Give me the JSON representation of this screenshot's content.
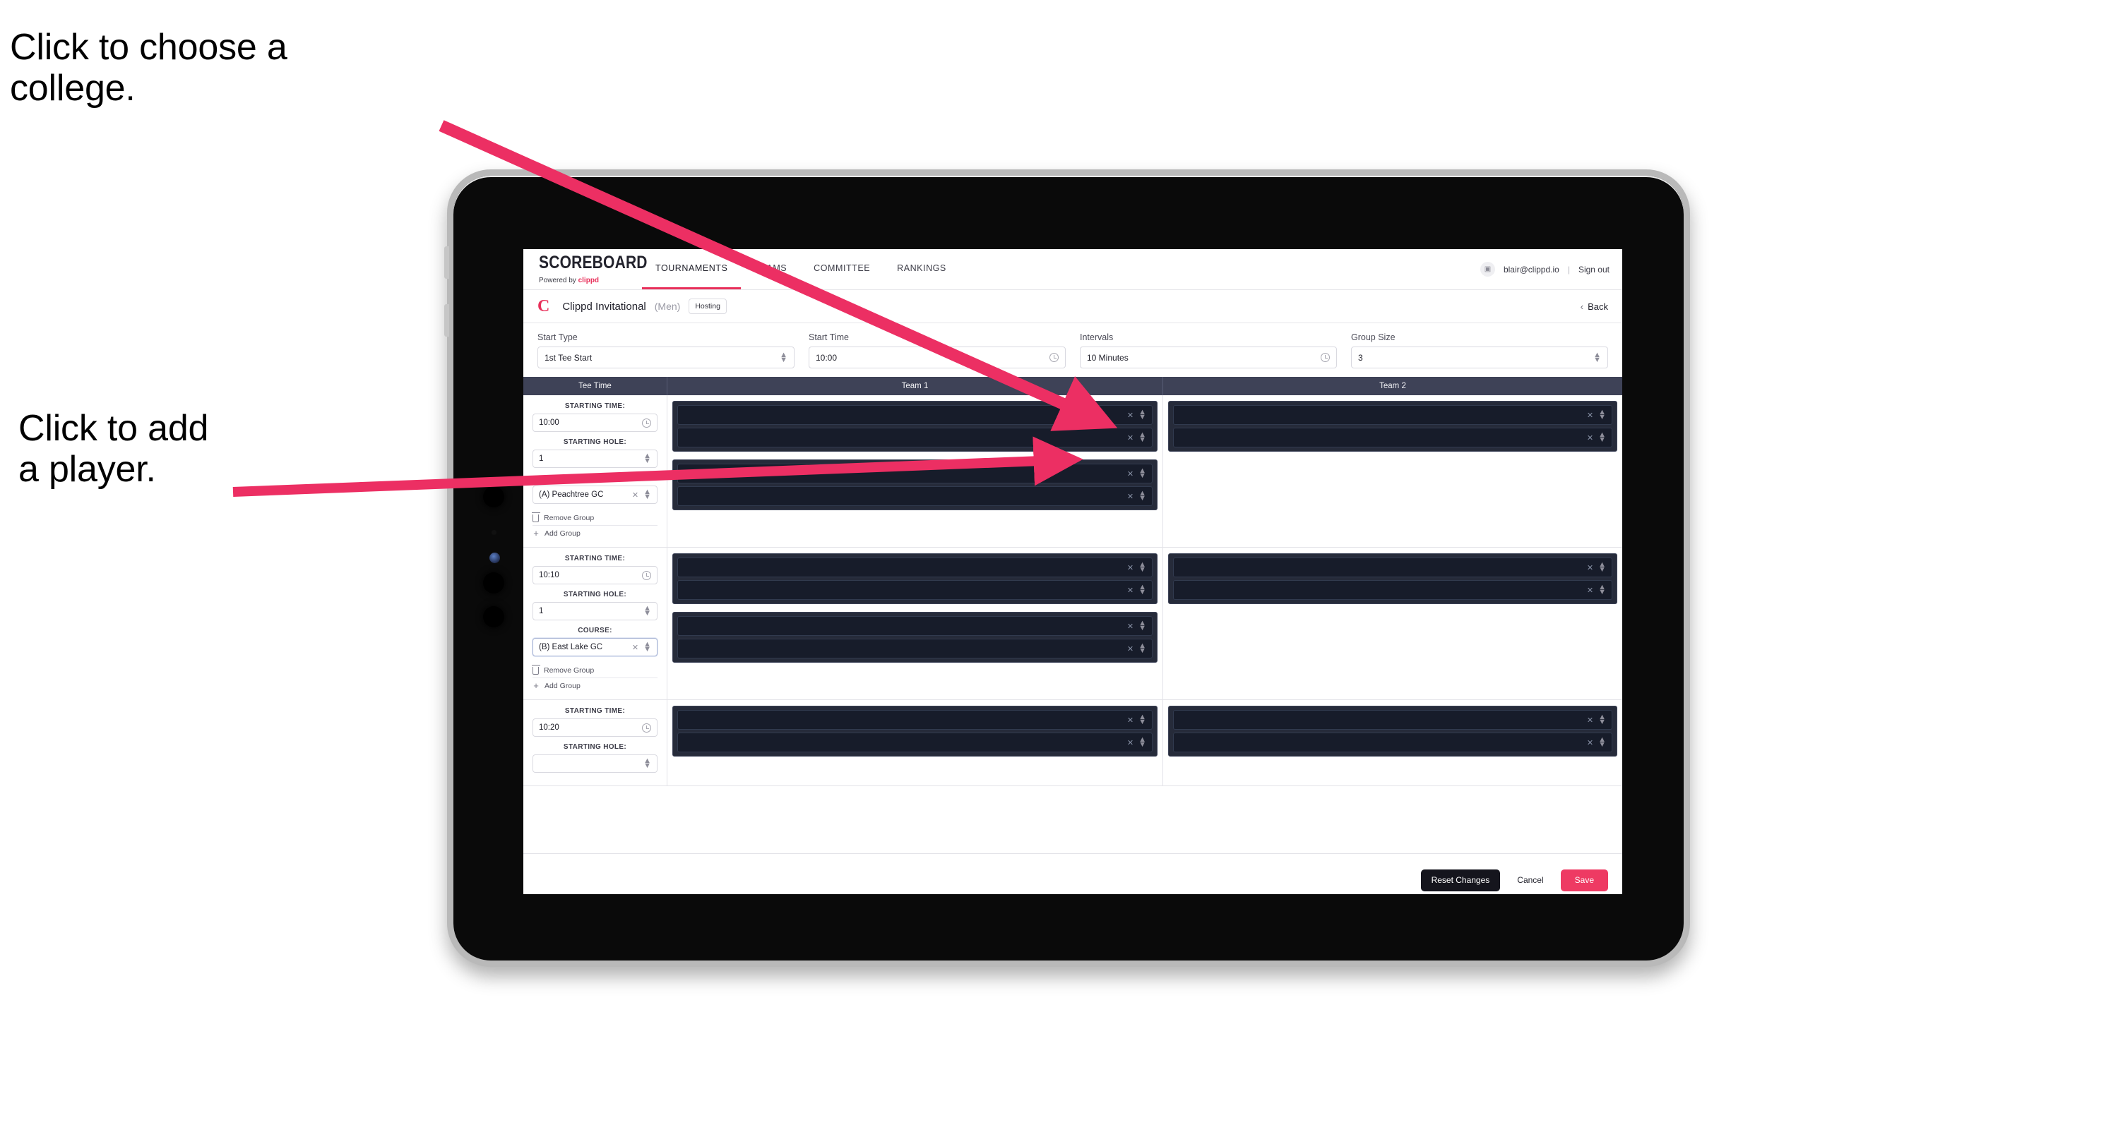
{
  "annotations": {
    "choose_college": "Click to choose a\ncollege.",
    "add_player": "Click to add\na player."
  },
  "app": {
    "brand": {
      "name": "SCOREBOARD",
      "powered_prefix": "Powered by ",
      "powered_brand": "clippd"
    },
    "nav_tabs": [
      {
        "label": "TOURNAMENTS",
        "active": true
      },
      {
        "label": "TEAMS",
        "active": false
      },
      {
        "label": "COMMITTEE",
        "active": false
      },
      {
        "label": "RANKINGS",
        "active": false
      }
    ],
    "account": {
      "avatar_icon": "user-avatar-icon",
      "email": "blair@clippd.io",
      "separator": "|",
      "sign_out": "Sign out"
    },
    "breadcrumb": {
      "logo_letter": "C",
      "title": "Clippd Invitational",
      "gender": "(Men)",
      "status_badge": "Hosting",
      "back_label": "Back",
      "back_chevron": "‹"
    },
    "settings": [
      {
        "label": "Start Type",
        "value": "1st Tee Start",
        "adorn": "stepper"
      },
      {
        "label": "Start Time",
        "value": "10:00",
        "adorn": "clock"
      },
      {
        "label": "Intervals",
        "value": "10 Minutes",
        "adorn": "clock"
      },
      {
        "label": "Group Size",
        "value": "3",
        "adorn": "stepper"
      }
    ],
    "table": {
      "headers": [
        "Tee Time",
        "Team 1",
        "Team 2"
      ],
      "field_labels": {
        "starting_time": "STARTING TIME:",
        "starting_hole": "STARTING HOLE:",
        "course": "COURSE:"
      },
      "group_actions": {
        "remove": "Remove Group",
        "add": "Add Group"
      },
      "tee_blocks": [
        {
          "starting_time": "10:00",
          "starting_hole": "1",
          "course": "(A) Peachtree GC",
          "course_focused": false,
          "team1_groups": [
            {
              "players": 2
            },
            {
              "players": 2
            }
          ],
          "team2_groups": [
            {
              "players": 2
            }
          ]
        },
        {
          "starting_time": "10:10",
          "starting_hole": "1",
          "course": "(B) East Lake GC",
          "course_focused": true,
          "team1_groups": [
            {
              "players": 2
            },
            {
              "players": 2
            }
          ],
          "team2_groups": [
            {
              "players": 2
            }
          ]
        },
        {
          "starting_time": "10:20",
          "starting_hole": "",
          "course": "",
          "course_focused": false,
          "team1_groups": [
            {
              "players": 2
            }
          ],
          "team2_groups": [
            {
              "players": 2
            }
          ]
        }
      ]
    },
    "footer": {
      "reset": "Reset Changes",
      "cancel": "Cancel",
      "save": "Save"
    },
    "colors": {
      "accent": "#ee3a63",
      "brand_pink": "#e8305a",
      "header_bar": "#3e4257",
      "row_dark": "#171c2a",
      "group_dark": "#262b3a",
      "dark_button": "#15151d",
      "annotation_arrow": "#ec2f63"
    }
  }
}
